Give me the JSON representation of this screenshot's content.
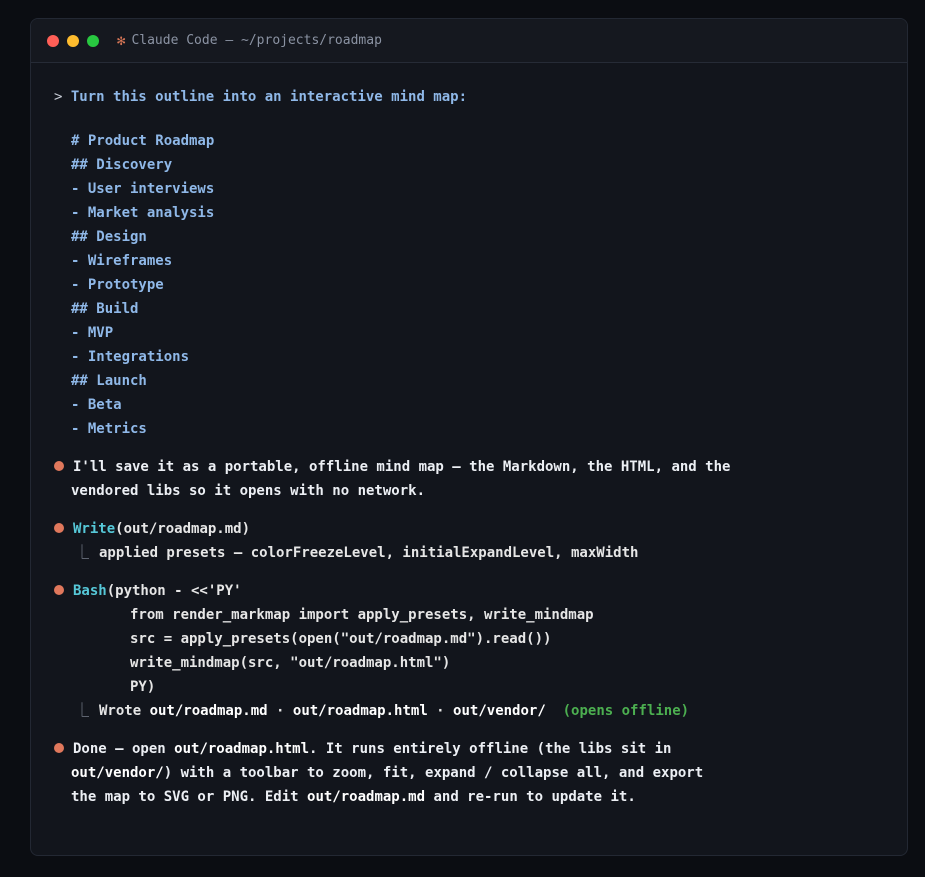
{
  "window": {
    "title_icon": "✻",
    "title": "Claude Code — ~/projects/roadmap"
  },
  "user": {
    "prompt_mark": ">",
    "message": "Turn this outline into an interactive mind map:",
    "outline": [
      "# Product Roadmap",
      "## Discovery",
      "- User interviews",
      "- Market analysis",
      "## Design",
      "- Wireframes",
      "- Prototype",
      "## Build",
      "- MVP",
      "- Integrations",
      "## Launch",
      "- Beta",
      "- Metrics"
    ]
  },
  "assistant": {
    "intro_line1": "I'll save it as a portable, offline mind map — the Markdown, the HTML, and the",
    "intro_line2": "vendored libs so it opens with no network.",
    "write_tool": {
      "name": "Write",
      "args": "(out/roadmap.md)",
      "result": "applied presets — colorFreezeLevel, initialExpandLevel, maxWidth"
    },
    "bash_tool": {
      "name": "Bash",
      "args": "(python - <<'PY'",
      "code": [
        "from render_markmap import apply_presets, write_mindmap",
        "src = apply_presets(open(\"out/roadmap.md\").read())",
        "write_mindmap(src, \"out/roadmap.html\")",
        "PY)"
      ],
      "result_prefix": "Wrote ",
      "file1": "out/roadmap.md",
      "sep": " · ",
      "file2": "out/roadmap.html",
      "file3": "out/vendor/",
      "note": "(opens offline)"
    },
    "done": {
      "l1_a": "Done — open ",
      "l1_b": "out/roadmap.html",
      "l1_c": ". It runs entirely offline (the libs sit in",
      "l2_a": "out/vendor/",
      "l2_b": ") with a toolbar to zoom, fit, expand / collapse all, and export",
      "l3_a": "the map to SVG or PNG. Edit ",
      "l3_b": "out/roadmap.md",
      "l3_c": " and re-run to update it."
    }
  },
  "colors": {
    "bullet": "#e0785c",
    "tool": "#56c8d8",
    "prompt": "#8fb8e8",
    "note": "#4caf50"
  }
}
